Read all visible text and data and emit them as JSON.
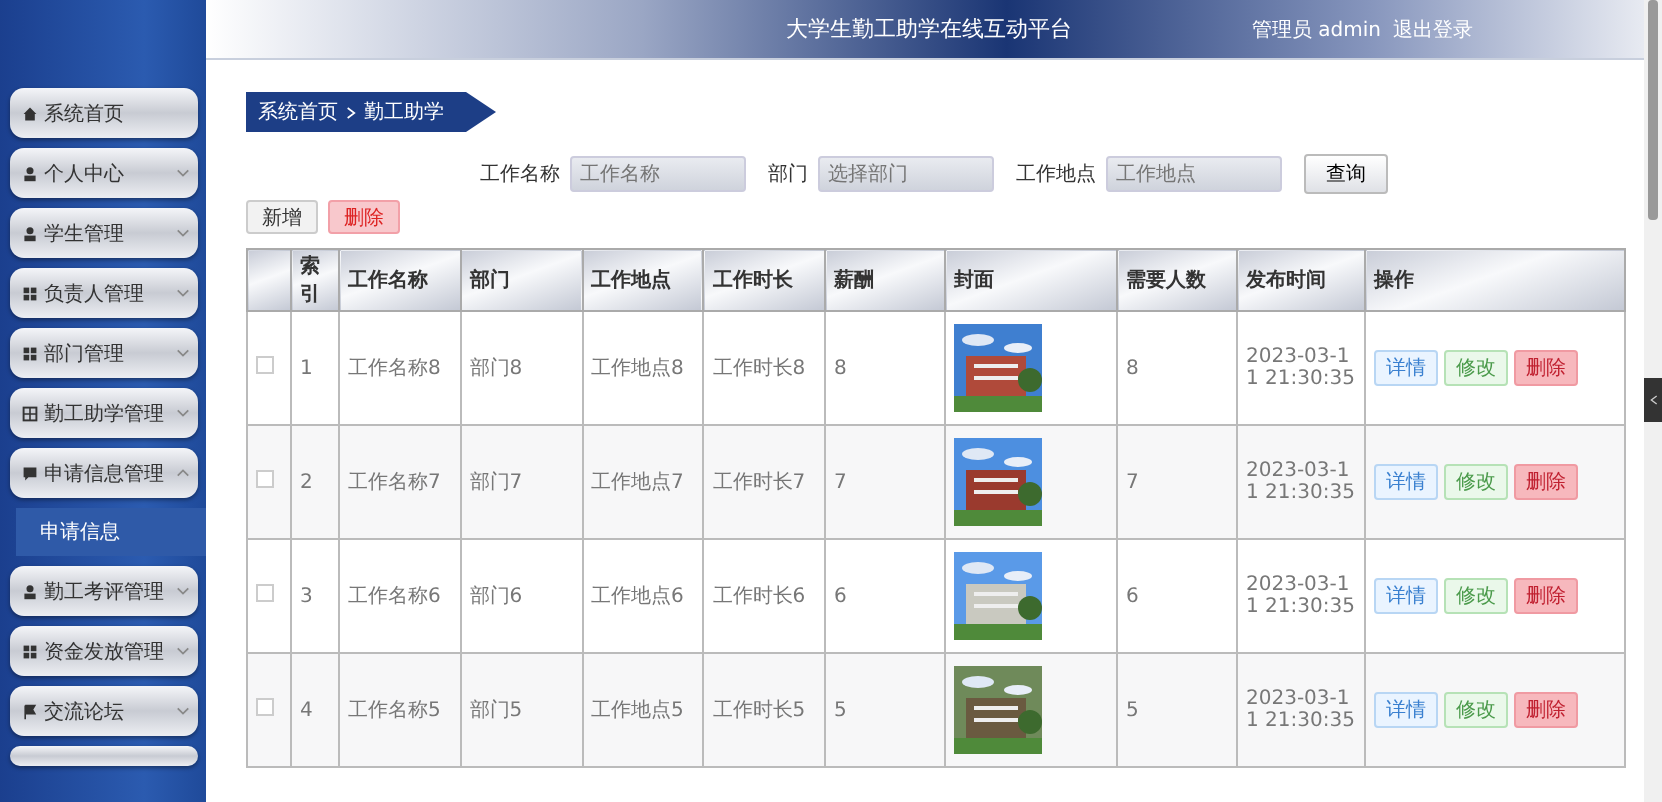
{
  "header": {
    "title": "大学生勤工助学在线互动平台",
    "user": "管理员 admin",
    "logout": "退出登录"
  },
  "sidebar": {
    "items": [
      {
        "label": "系统首页"
      },
      {
        "label": "个人中心",
        "expanded": false
      },
      {
        "label": "学生管理",
        "expanded": false
      },
      {
        "label": "负责人管理",
        "expanded": false
      },
      {
        "label": "部门管理",
        "expanded": false
      },
      {
        "label": "勤工助学管理",
        "expanded": false
      },
      {
        "label": "申请信息管理",
        "expanded": true,
        "children": [
          {
            "label": "申请信息"
          }
        ]
      },
      {
        "label": "勤工考评管理",
        "expanded": false
      },
      {
        "label": "资金发放管理",
        "expanded": false
      },
      {
        "label": "交流论坛",
        "expanded": false
      }
    ]
  },
  "breadcrumb": [
    "系统首页",
    "勤工助学"
  ],
  "search": {
    "fields": [
      {
        "label": "工作名称",
        "placeholder": "工作名称"
      },
      {
        "label": "部门",
        "placeholder": "选择部门"
      },
      {
        "label": "工作地点",
        "placeholder": "工作地点"
      }
    ],
    "button": "查询"
  },
  "actions": [
    {
      "label": "新增",
      "kind": "plain"
    },
    {
      "label": "删除",
      "kind": "danger"
    }
  ],
  "table": {
    "columns": [
      "",
      "索引",
      "工作名称",
      "部门",
      "工作地点",
      "工作时长",
      "薪酬",
      "封面",
      "需要人数",
      "发布时间",
      "操作"
    ],
    "rows": [
      {
        "checked": false,
        "index": "1",
        "name": "工作名称8",
        "dept": "部门8",
        "place": "工作地点8",
        "duration": "工作时长8",
        "pay": "8",
        "cover": {
          "kind": "picture"
        },
        "people": "8",
        "time": "2023-03-11 21:30:35",
        "actions": [
          {
            "label": "详情",
            "kind": "info"
          },
          {
            "label": "修改",
            "kind": "success"
          },
          {
            "label": "删除",
            "kind": "danger"
          }
        ]
      },
      {
        "checked": false,
        "index": "2",
        "name": "工作名称7",
        "dept": "部门7",
        "place": "工作地点7",
        "duration": "工作时长7",
        "pay": "7",
        "cover": {
          "kind": "picture"
        },
        "people": "7",
        "time": "2023-03-11 21:30:35",
        "actions": [
          {
            "label": "详情",
            "kind": "info"
          },
          {
            "label": "修改",
            "kind": "success"
          },
          {
            "label": "删除",
            "kind": "danger"
          }
        ]
      },
      {
        "checked": false,
        "index": "3",
        "name": "工作名称6",
        "dept": "部门6",
        "place": "工作地点6",
        "duration": "工作时长6",
        "pay": "6",
        "cover": {
          "kind": "picture"
        },
        "people": "6",
        "time": "2023-03-11 21:30:35",
        "actions": [
          {
            "label": "详情",
            "kind": "info"
          },
          {
            "label": "修改",
            "kind": "success"
          },
          {
            "label": "删除",
            "kind": "danger"
          }
        ]
      },
      {
        "checked": false,
        "index": "4",
        "name": "工作名称5",
        "dept": "部门5",
        "place": "工作地点5",
        "duration": "工作时长5",
        "pay": "5",
        "cover": {
          "kind": "picture"
        },
        "people": "5",
        "time": "2023-03-11 21:30:35",
        "actions": [
          {
            "label": "详情",
            "kind": "info"
          },
          {
            "label": "修改",
            "kind": "success"
          },
          {
            "label": "删除",
            "kind": "danger"
          }
        ]
      }
    ]
  }
}
